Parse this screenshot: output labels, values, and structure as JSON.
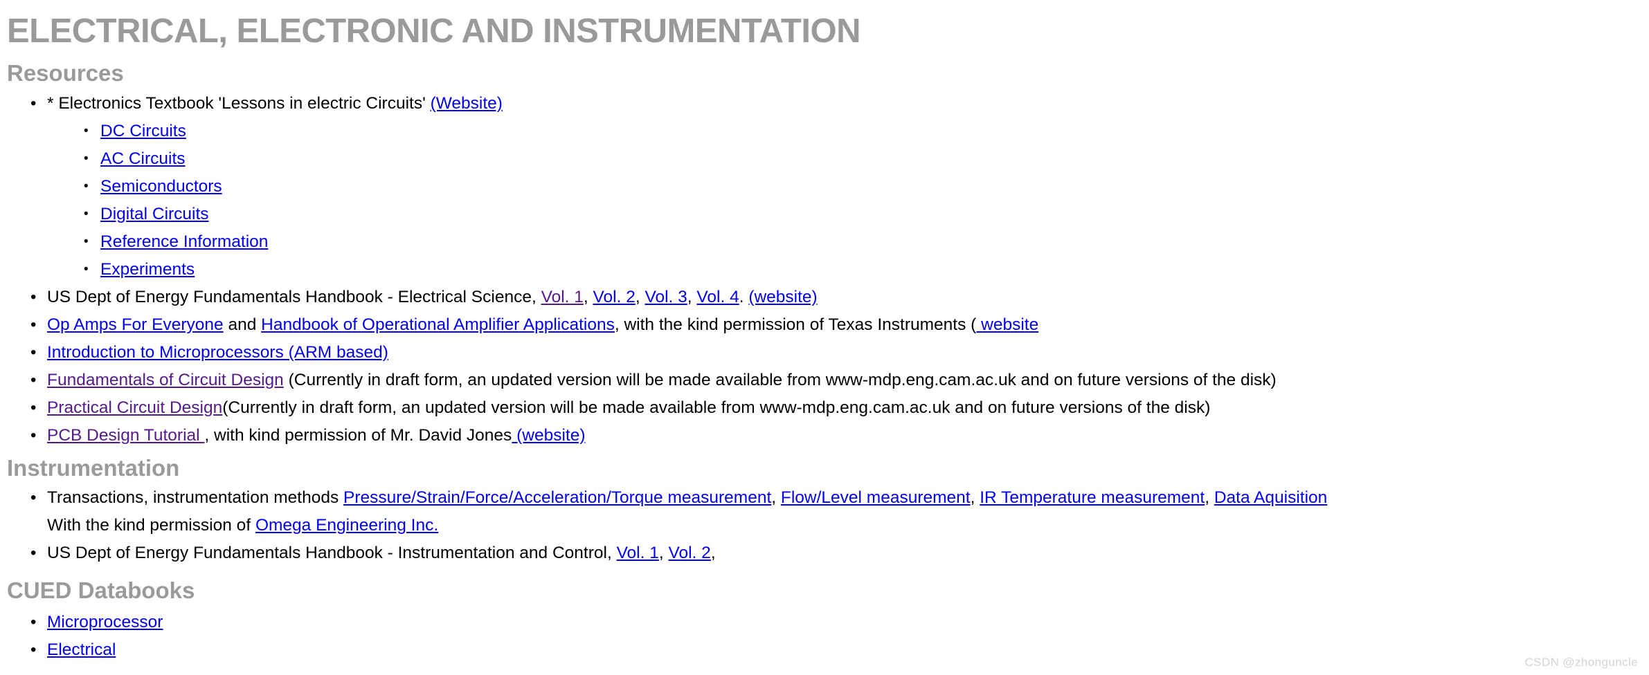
{
  "document": {
    "title": "ELECTRICAL, ELECTRONIC AND INSTRUMENTATION",
    "watermark": "CSDN @zhonguncle"
  },
  "colors": {
    "heading_gray": "#9a9a9a",
    "link_unvisited": "#0000ee",
    "link_visited": "#551a8b",
    "body_text": "#000000",
    "watermark": "#d4d4d4",
    "background": "#ffffff"
  },
  "sections": {
    "resources": {
      "heading": "Resources",
      "items": {
        "textbook": {
          "prefix": "* Electronics Textbook 'Lessons in electric Circuits' ",
          "website_link": "(Website)",
          "sublinks": [
            "DC Circuits",
            "AC Circuits",
            "Semiconductors",
            "Digital Circuits",
            "Reference Information",
            "Experiments"
          ]
        },
        "doe_electrical": {
          "prefix": "US Dept of Energy Fundamentals Handbook - Electrical Science, ",
          "vol1": "Vol. 1",
          "sep1": ", ",
          "vol2": "Vol. 2",
          "sep2": ", ",
          "vol3": "Vol. 3",
          "sep3": ", ",
          "vol4": "Vol. 4",
          "sep4": ". ",
          "website_link": "(website)"
        },
        "op_amps": {
          "link1": "Op Amps For Everyone",
          "mid": " and ",
          "link2": "Handbook of Operational Amplifier Applications",
          "suffix": ", with the kind permission of Texas Instruments (",
          "website_link": " website"
        },
        "microprocessors": {
          "link": "Introduction to Microprocessors (ARM based)"
        },
        "fundamentals": {
          "link": "Fundamentals of Circuit Design",
          "suffix": " (Currently in draft form, an updated version will be made available from www-mdp.eng.cam.ac.uk and on future versions of the disk)"
        },
        "practical": {
          "link": "Practical Circuit Design",
          "suffix": "(Currently in draft form, an updated version will be made available from www-mdp.eng.cam.ac.uk and on future versions of the disk)"
        },
        "pcb": {
          "link": "PCB Design Tutorial ",
          "mid": ", with kind permission of Mr. David Jones",
          "website_link": " (website)"
        }
      }
    },
    "instrumentation": {
      "heading": "Instrumentation",
      "items": {
        "transactions": {
          "prefix": "Transactions, instrumentation methods ",
          "link1": "Pressure/Strain/Force/Acceleration/Torque measurement",
          "sep1": ", ",
          "link2": "Flow/Level measurement",
          "sep2": ", ",
          "link3": "IR Temperature measurement",
          "sep3": ", ",
          "link4": "Data Aquisition",
          "line2_prefix": "With the kind permission of ",
          "line2_link": "Omega Engineering Inc."
        },
        "doe_instrumentation": {
          "prefix": "US Dept of Energy Fundamentals Handbook - Instrumentation and Control, ",
          "vol1": "Vol. 1",
          "sep1": ", ",
          "vol2": "Vol. 2",
          "sep2": ","
        }
      }
    },
    "cued_databooks": {
      "heading": "CUED Databooks",
      "items": [
        "Microprocessor",
        "Electrical"
      ]
    }
  }
}
